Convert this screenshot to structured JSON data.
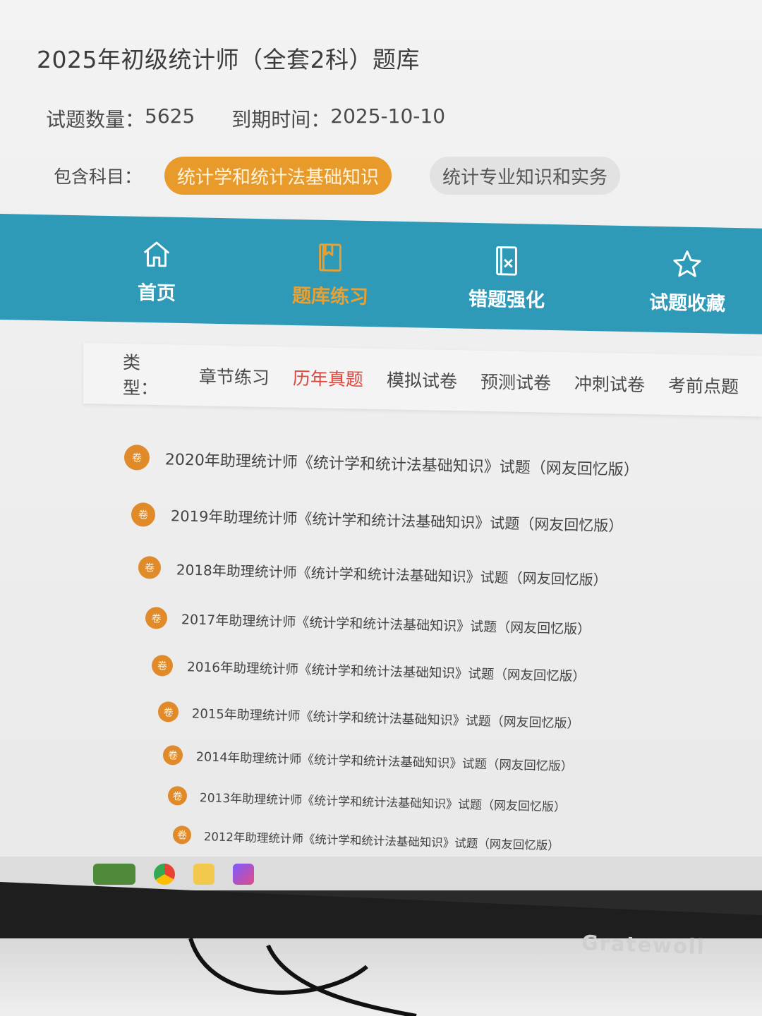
{
  "header": {
    "title": "2025年初级统计师（全套2科）题库",
    "question_count_label": "试题数量：",
    "question_count": "5625",
    "expiry_label": "到期时间：",
    "expiry_date": "2025-10-10",
    "subjects_label": "包含科目："
  },
  "subjects": [
    {
      "label": "统计学和统计法基础知识",
      "active": true
    },
    {
      "label": "统计专业知识和实务",
      "active": false
    }
  ],
  "nav": [
    {
      "label": "首页",
      "icon": "home-icon",
      "active": false
    },
    {
      "label": "题库练习",
      "icon": "book-icon",
      "active": true
    },
    {
      "label": "错题强化",
      "icon": "wrong-doc-icon",
      "active": false
    },
    {
      "label": "试题收藏",
      "icon": "star-icon",
      "active": false
    }
  ],
  "type_filter": {
    "label": "类型：",
    "tabs": [
      "章节练习",
      "历年真题",
      "模拟试卷",
      "预测试卷",
      "冲刺试卷",
      "考前点题"
    ],
    "active_index": 1
  },
  "exam_badge_text": "卷",
  "exams": [
    "2020年助理统计师《统计学和统计法基础知识》试题（网友回忆版）",
    "2019年助理统计师《统计学和统计法基础知识》试题（网友回忆版）",
    "2018年助理统计师《统计学和统计法基础知识》试题（网友回忆版）",
    "2017年助理统计师《统计学和统计法基础知识》试题（网友回忆版）",
    "2016年助理统计师《统计学和统计法基础知识》试题（网友回忆版）",
    "2015年助理统计师《统计学和统计法基础知识》试题（网友回忆版）",
    "2014年助理统计师《统计学和统计法基础知识》试题（网友回忆版）",
    "2013年助理统计师《统计学和统计法基础知识》试题（网友回忆版）",
    "2012年助理统计师《统计学和统计法基础知识》试题（网友回忆版）"
  ],
  "monitor_brand": "Gratewoll",
  "colors": {
    "accent": "#e89a2b",
    "nav_bg": "#2f9ab8",
    "active_tab": "#e0463c"
  }
}
